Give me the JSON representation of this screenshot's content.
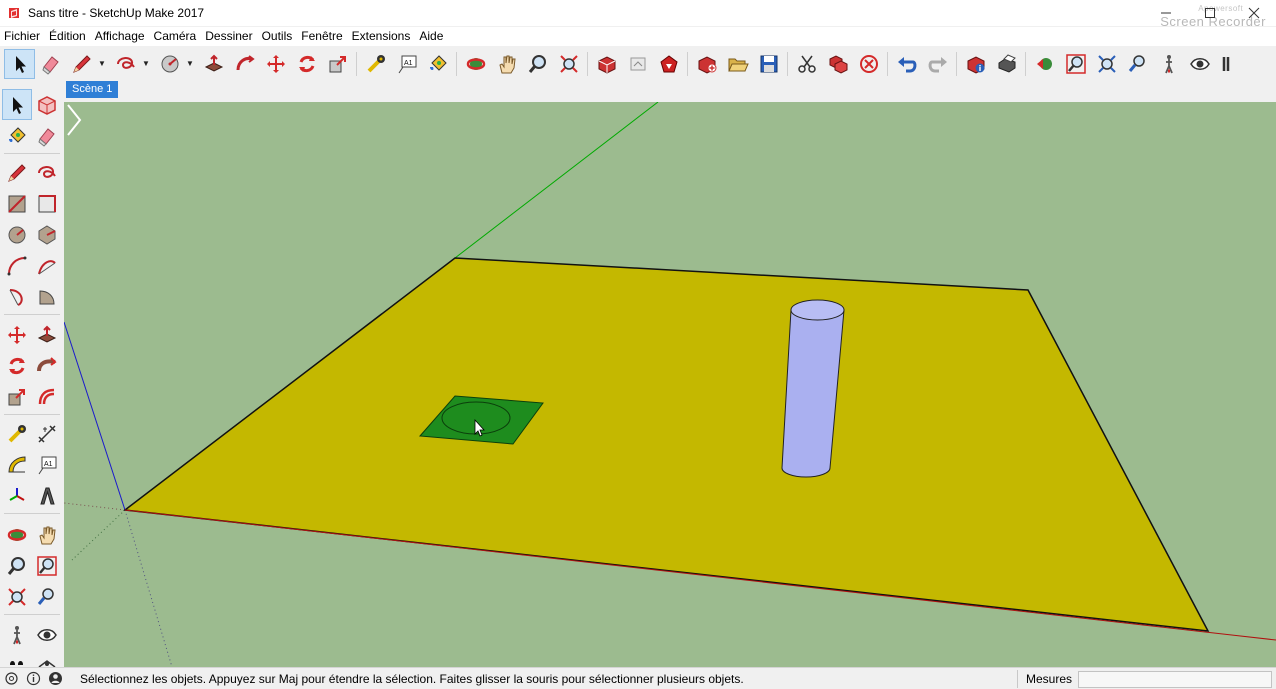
{
  "window": {
    "title": "Sans titre - SketchUp Make 2017",
    "app_icon": "sketchup-icon",
    "controls": [
      "minimize",
      "maximize",
      "close"
    ],
    "watermark_small": "Apowersoft",
    "watermark": "Screen Recorder"
  },
  "menu": [
    "Fichier",
    "Édition",
    "Affichage",
    "Caméra",
    "Dessiner",
    "Outils",
    "Fenêtre",
    "Extensions",
    "Aide"
  ],
  "toolbar": {
    "icons": [
      "select-icon",
      "eraser-icon",
      "pencil-icon",
      "freehand-icon",
      "circle-icon",
      "push-pull-icon",
      "follow-me-icon",
      "move-icon",
      "rotate-icon",
      "scale-icon",
      "tape-measure-icon",
      "text-icon",
      "paint-bucket-icon",
      "orbit-icon",
      "pan-icon",
      "zoom-icon",
      "zoom-extents-icon",
      "get-models-icon",
      "share-model-icon",
      "extension-warehouse-icon",
      "new-file-icon",
      "open-file-icon",
      "save-icon",
      "cut-icon",
      "copy-icon",
      "delete-icon",
      "undo-icon",
      "redo-icon",
      "model-info-icon",
      "print-icon",
      "previous-view-icon",
      "zoom-window-icon",
      "zoom-fit-icon",
      "position-camera-icon",
      "walk-icon",
      "look-around-icon",
      "section-icon"
    ]
  },
  "scene_tab": "Scène 1",
  "left_toolbar": {
    "icons": [
      "select-icon",
      "make-component-icon",
      "paint-bucket-icon",
      "eraser-icon",
      "pencil-icon",
      "freehand-icon",
      "rectangle-icon",
      "rotated-rectangle-icon",
      "circle-icon",
      "polygon-icon",
      "arc-icon",
      "two-point-arc-icon",
      "three-point-arc-icon",
      "pie-icon",
      "move-icon",
      "push-pull-icon",
      "rotate-icon",
      "follow-me-icon",
      "scale-icon",
      "offset-icon",
      "tape-measure-icon",
      "dimension-icon",
      "protractor-icon",
      "text-icon",
      "axes-icon",
      "3d-text-icon",
      "orbit-icon",
      "pan-icon",
      "zoom-icon",
      "zoom-window-icon",
      "zoom-extents-icon",
      "previous-view-icon",
      "position-camera-icon",
      "look-around-icon",
      "walk-icon",
      "section-plane-icon"
    ]
  },
  "viewport": {
    "background": "#9cbb8f",
    "ground_color": "#c4b800",
    "small_face_color": "#1e8c1e",
    "cylinder_color": "#aab0f0",
    "axis_red": "#b01010",
    "axis_green": "#00aa00",
    "axis_blue": "#1a1acc"
  },
  "status": {
    "icons": [
      "geolocation-icon",
      "info-icon",
      "user-icon"
    ],
    "text": "Sélectionnez les objets. Appuyez sur Maj pour étendre la sélection. Faites glisser la souris pour sélectionner plusieurs objets.",
    "measure_label": "Mesures",
    "measure_value": ""
  }
}
